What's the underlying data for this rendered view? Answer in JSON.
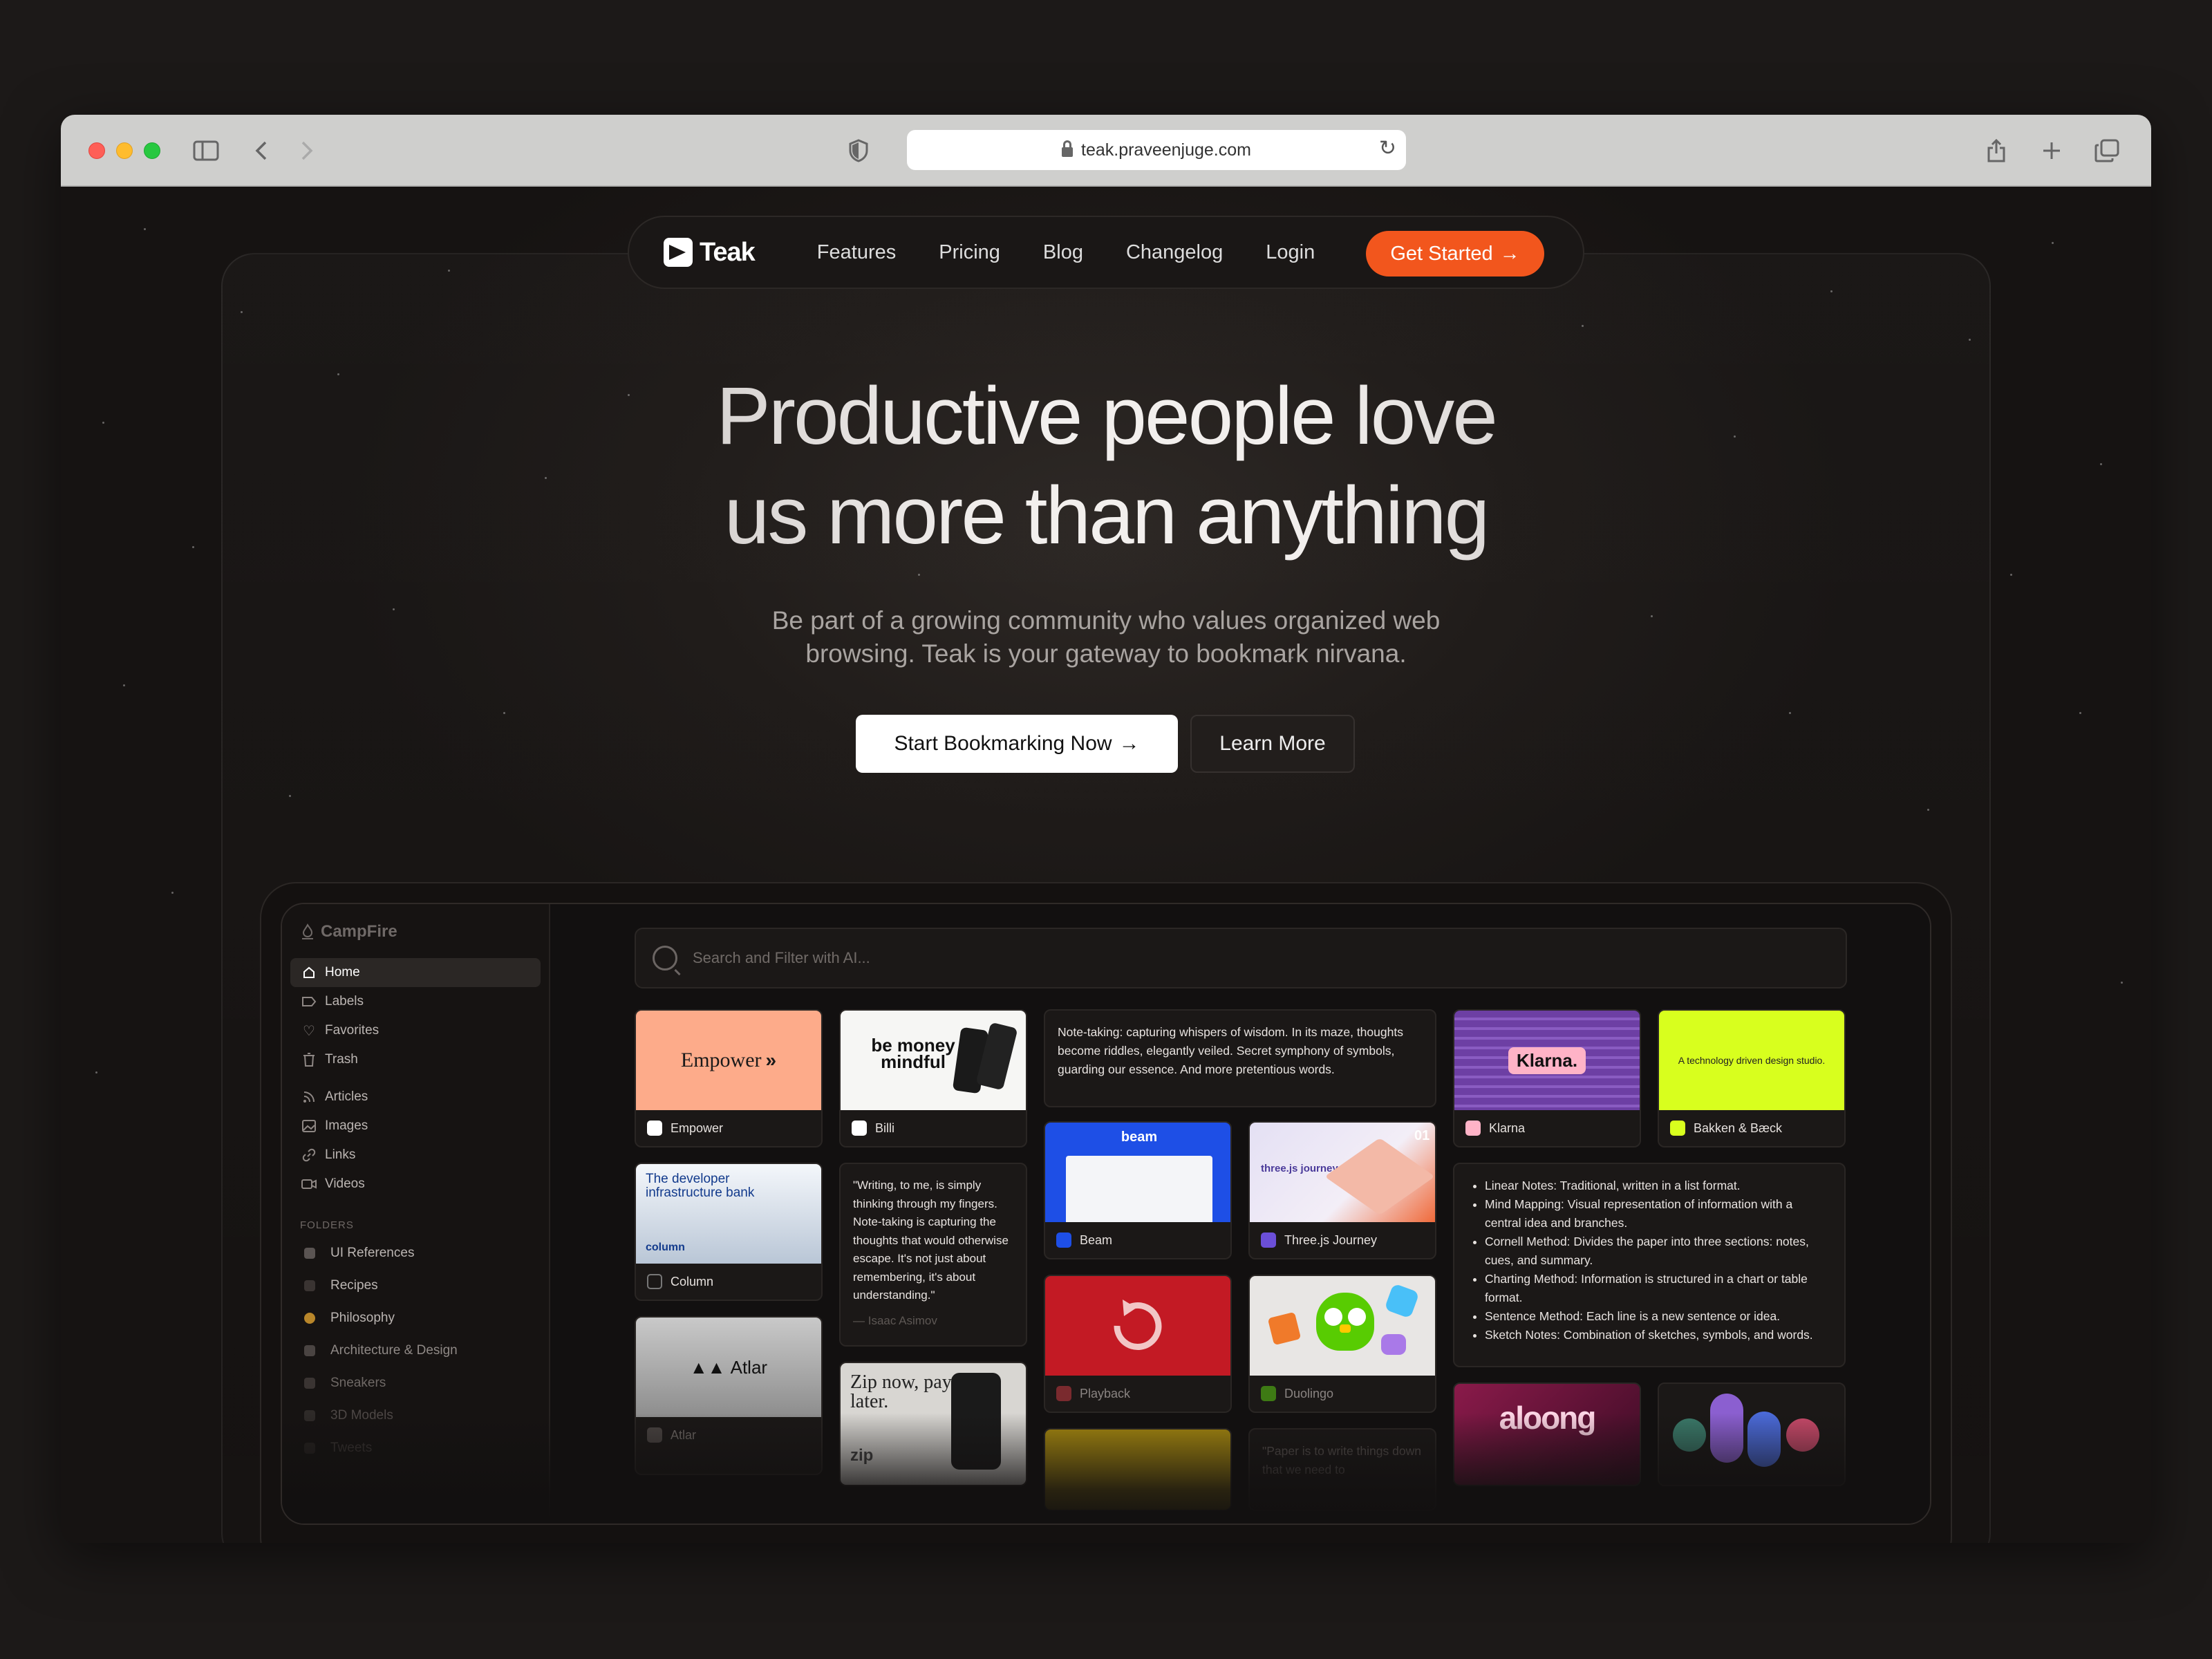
{
  "browser": {
    "url": "teak.praveenjuge.com"
  },
  "nav": {
    "logo": "Teak",
    "links": [
      "Features",
      "Pricing",
      "Blog",
      "Changelog",
      "Login"
    ],
    "cta": "Get Started"
  },
  "hero": {
    "title_line1": "Productive people love",
    "title_line2": "us more than anything",
    "subtitle": "Be part of a growing community who values organized web browsing. Teak is your gateway to bookmark nirvana.",
    "primary_button": "Start Bookmarking Now",
    "secondary_button": "Learn More"
  },
  "app": {
    "brand": "CampFire",
    "sidebar": {
      "primary": [
        "Home",
        "Labels",
        "Favorites",
        "Trash"
      ],
      "types": [
        "Articles",
        "Images",
        "Links",
        "Videos"
      ],
      "folders_label": "FOLDERS",
      "folders": [
        "UI References",
        "Recipes",
        "Philosophy",
        "Architecture & Design",
        "Sneakers",
        "3D Models",
        "Tweets"
      ]
    },
    "search_placeholder": "Search and Filter with AI...",
    "cards": {
      "empower": {
        "label": "Empower",
        "thumb_text": "Empower"
      },
      "billi": {
        "label": "Billi",
        "thumb_text": "be money mindful"
      },
      "beam": {
        "label": "Beam",
        "thumb_text": "beam"
      },
      "threejs": {
        "label": "Three.js Journey",
        "thumb_text": "three.js journey",
        "badge": "01"
      },
      "klarna": {
        "label": "Klarna",
        "thumb_text": "Klarna."
      },
      "bakken": {
        "label": "Bakken & Bæck",
        "thumb_text": "A technology driven design studio."
      },
      "column": {
        "label": "Column",
        "thumb_text": "The developer infrastructure bank",
        "thumb_sub": "column"
      },
      "atlar": {
        "label": "Atlar",
        "thumb_text": "Atlar"
      },
      "playback": {
        "label": "Playback"
      },
      "duolingo": {
        "label": "Duolingo"
      },
      "zip": {
        "thumb_text": "Zip now, pay later.",
        "thumb_sub": "zip"
      },
      "aloong": {
        "thumb_text": "aloong"
      }
    },
    "notes": {
      "wisdom": "Note-taking: capturing whispers of wisdom. In its maze, thoughts become riddles, elegantly veiled. Secret symphony of symbols, guarding our essence. And more pretentious words.",
      "quote": "\"Writing, to me, is simply thinking through my fingers. Note-taking is capturing the thoughts that would otherwise escape. It's not just about remembering, it's about understanding.\"",
      "quote_attrib": "— Isaac Asimov",
      "paper": "\"Paper is to write things down that we need to",
      "methods": [
        "Linear Notes: Traditional, written in a list format.",
        "Mind Mapping: Visual representation of information with a central idea and branches.",
        "Cornell Method: Divides the paper into three sections: notes, cues, and summary.",
        "Charting Method: Information is structured in a chart or table format.",
        "Sentence Method: Each line is a new sentence or idea.",
        "Sketch Notes: Combination of sketches, symbols, and words."
      ]
    }
  },
  "colors": {
    "accent": "#f2561d",
    "background": "#161312"
  }
}
